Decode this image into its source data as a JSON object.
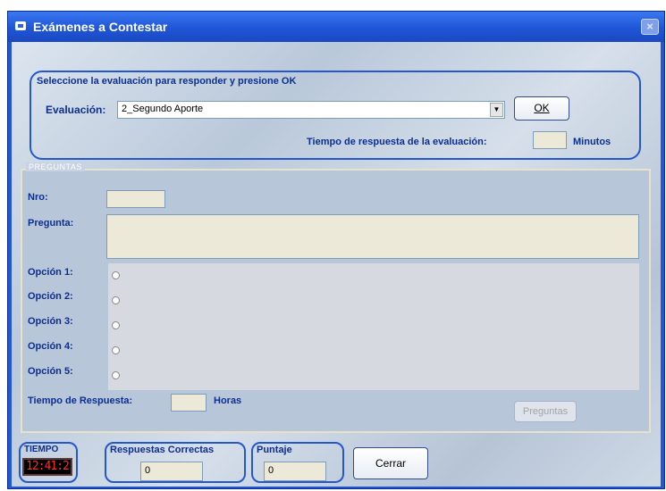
{
  "window": {
    "title": "Exámenes a Contestar",
    "close_glyph": "×"
  },
  "selection": {
    "instruction": "Seleccione la evaluación para responder y presione OK",
    "evaluacion_label": "Evaluación:",
    "evaluacion_value": "2_Segundo Aporte",
    "ok_label": "OK",
    "tiempo_label": "Tiempo de respuesta de la evaluación:",
    "tiempo_value": "",
    "tiempo_unit": "Minutos"
  },
  "preguntas": {
    "legend": "PREGUNTAS",
    "nro_label": "Nro:",
    "nro_value": "",
    "pregunta_label": "Pregunta:",
    "pregunta_value": "",
    "options": [
      {
        "label": "Opción 1:"
      },
      {
        "label": "Opción 2:"
      },
      {
        "label": "Opción 3:"
      },
      {
        "label": "Opción 4:"
      },
      {
        "label": "Opción 5:"
      }
    ],
    "tiempo_respuesta_label": "Tiempo de Respuesta:",
    "tiempo_respuesta_value": "",
    "tiempo_respuesta_unit": "Horas",
    "preguntas_button": "Preguntas"
  },
  "footer": {
    "tiempo_label": "TIEMPO",
    "clock_value": "12:41:2",
    "correctas_label": "Respuestas Correctas",
    "correctas_value": "0",
    "puntaje_label": "Puntaje",
    "puntaje_value": "0",
    "cerrar_label": "Cerrar"
  },
  "colors": {
    "title_bar": "#2356d6",
    "label_text": "#0c2f8f",
    "clock_digits": "#ff2a2a"
  }
}
